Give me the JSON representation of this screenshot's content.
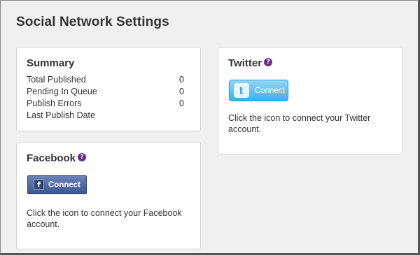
{
  "page": {
    "title": "Social Network Settings"
  },
  "summary": {
    "title": "Summary",
    "rows": [
      {
        "label": "Total Published",
        "value": "0"
      },
      {
        "label": "Pending In Queue",
        "value": "0"
      },
      {
        "label": "Publish Errors",
        "value": "0"
      },
      {
        "label": "Last Publish Date",
        "value": ""
      }
    ]
  },
  "facebook": {
    "title": "Facebook",
    "help": "?",
    "button_logo": "f",
    "button_label": "Connect",
    "description": "Click the icon to connect your Facebook account."
  },
  "twitter": {
    "title": "Twitter",
    "help": "?",
    "button_logo": "t",
    "button_label": "Connect",
    "description": "Click the icon to connect your Twitter account."
  },
  "colors": {
    "help_badge": "#6b2c8c",
    "facebook_button": "#3b5693",
    "twitter_button": "#3fb0e6"
  },
  "icons": [
    "help-icon",
    "facebook-logo-icon",
    "twitter-logo-icon"
  ]
}
